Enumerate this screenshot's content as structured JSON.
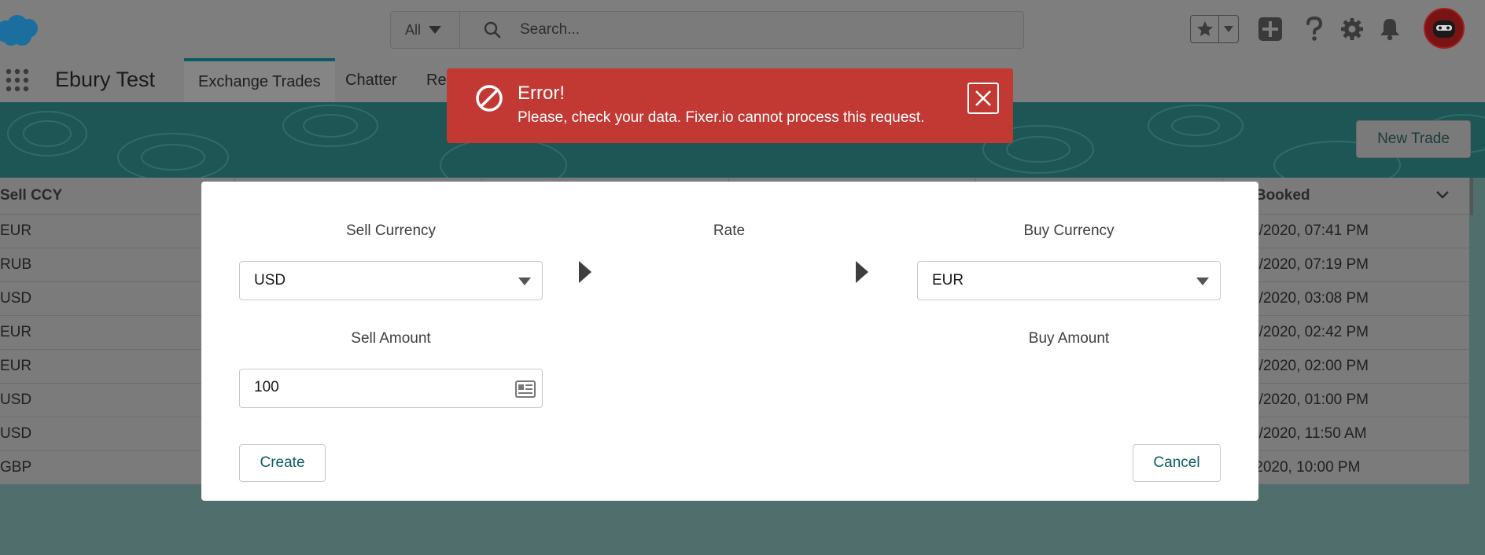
{
  "header": {
    "search_scope": "All",
    "search_placeholder": "Search..."
  },
  "nav": {
    "app_name": "Ebury Test",
    "tabs": [
      {
        "label": "Exchange Trades"
      },
      {
        "label": "Chatter"
      },
      {
        "label": "Re"
      }
    ]
  },
  "page": {
    "new_trade_label": "New Trade"
  },
  "table": {
    "columns": [
      "Sell CCY",
      "e Booked"
    ],
    "rows": [
      {
        "sell_ccy": "EUR",
        "date_booked": "2/2020, 07:41 PM"
      },
      {
        "sell_ccy": "RUB",
        "date_booked": "2/2020, 07:19 PM"
      },
      {
        "sell_ccy": "USD",
        "date_booked": "2/2020, 03:08 PM"
      },
      {
        "sell_ccy": "EUR",
        "date_booked": "2/2020, 02:42 PM"
      },
      {
        "sell_ccy": "EUR",
        "date_booked": "2/2020, 02:00 PM"
      },
      {
        "sell_ccy": "USD",
        "date_booked": "2/2020, 01:00 PM"
      },
      {
        "sell_ccy": "USD",
        "date_booked": "2/2020, 11:50 AM"
      },
      {
        "sell_ccy": "GBP",
        "date_booked": "/2020, 10:00 PM"
      }
    ]
  },
  "modal": {
    "sell_currency_label": "Sell Currency",
    "sell_currency_value": "USD",
    "rate_label": "Rate",
    "buy_currency_label": "Buy Currency",
    "buy_currency_value": "EUR",
    "sell_amount_label": "Sell Amount",
    "sell_amount_value": "100",
    "buy_amount_label": "Buy Amount",
    "create_label": "Create",
    "cancel_label": "Cancel"
  },
  "toast": {
    "title": "Error!",
    "message": "Please, check your data. Fixer.io cannot process this request."
  },
  "icons": {
    "logo": "salesforce-cloud-logo",
    "search": "search-icon",
    "favorite": "star-icon",
    "add": "plus-icon",
    "help": "question-icon",
    "setup": "gear-icon",
    "notifications": "bell-icon",
    "app_launcher": "waffle-icon",
    "calculator": "calculator-icon",
    "error": "ban-icon",
    "close": "close-icon"
  },
  "colors": {
    "error_toast": "#c23934",
    "brand_teal": "#0b5b63",
    "overlay_header": "#7e7e7e"
  }
}
